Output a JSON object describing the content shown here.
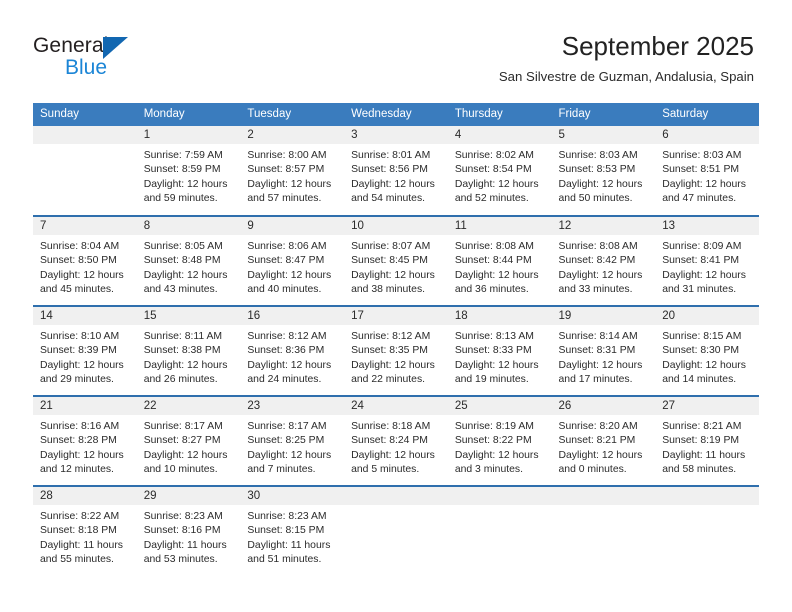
{
  "brand": {
    "name_top": "General",
    "name_bottom": "Blue",
    "triangle_color": "#1267b1",
    "blue_text_color": "#1b85d6"
  },
  "header": {
    "month_title": "September 2025",
    "location": "San Silvestre de Guzman, Andalusia, Spain",
    "header_bg": "#3a7cbe",
    "row_divider_color": "#2f6fad",
    "daynum_bg": "#f0f0f0"
  },
  "weekday_headers": [
    "Sunday",
    "Monday",
    "Tuesday",
    "Wednesday",
    "Thursday",
    "Friday",
    "Saturday"
  ],
  "weeks": [
    [
      {
        "day": "",
        "sunrise": "",
        "sunset": "",
        "daylight1": "",
        "daylight2": "",
        "empty": true
      },
      {
        "day": "1",
        "sunrise": "Sunrise: 7:59 AM",
        "sunset": "Sunset: 8:59 PM",
        "daylight1": "Daylight: 12 hours",
        "daylight2": "and 59 minutes."
      },
      {
        "day": "2",
        "sunrise": "Sunrise: 8:00 AM",
        "sunset": "Sunset: 8:57 PM",
        "daylight1": "Daylight: 12 hours",
        "daylight2": "and 57 minutes."
      },
      {
        "day": "3",
        "sunrise": "Sunrise: 8:01 AM",
        "sunset": "Sunset: 8:56 PM",
        "daylight1": "Daylight: 12 hours",
        "daylight2": "and 54 minutes."
      },
      {
        "day": "4",
        "sunrise": "Sunrise: 8:02 AM",
        "sunset": "Sunset: 8:54 PM",
        "daylight1": "Daylight: 12 hours",
        "daylight2": "and 52 minutes."
      },
      {
        "day": "5",
        "sunrise": "Sunrise: 8:03 AM",
        "sunset": "Sunset: 8:53 PM",
        "daylight1": "Daylight: 12 hours",
        "daylight2": "and 50 minutes."
      },
      {
        "day": "6",
        "sunrise": "Sunrise: 8:03 AM",
        "sunset": "Sunset: 8:51 PM",
        "daylight1": "Daylight: 12 hours",
        "daylight2": "and 47 minutes."
      }
    ],
    [
      {
        "day": "7",
        "sunrise": "Sunrise: 8:04 AM",
        "sunset": "Sunset: 8:50 PM",
        "daylight1": "Daylight: 12 hours",
        "daylight2": "and 45 minutes."
      },
      {
        "day": "8",
        "sunrise": "Sunrise: 8:05 AM",
        "sunset": "Sunset: 8:48 PM",
        "daylight1": "Daylight: 12 hours",
        "daylight2": "and 43 minutes."
      },
      {
        "day": "9",
        "sunrise": "Sunrise: 8:06 AM",
        "sunset": "Sunset: 8:47 PM",
        "daylight1": "Daylight: 12 hours",
        "daylight2": "and 40 minutes."
      },
      {
        "day": "10",
        "sunrise": "Sunrise: 8:07 AM",
        "sunset": "Sunset: 8:45 PM",
        "daylight1": "Daylight: 12 hours",
        "daylight2": "and 38 minutes."
      },
      {
        "day": "11",
        "sunrise": "Sunrise: 8:08 AM",
        "sunset": "Sunset: 8:44 PM",
        "daylight1": "Daylight: 12 hours",
        "daylight2": "and 36 minutes."
      },
      {
        "day": "12",
        "sunrise": "Sunrise: 8:08 AM",
        "sunset": "Sunset: 8:42 PM",
        "daylight1": "Daylight: 12 hours",
        "daylight2": "and 33 minutes."
      },
      {
        "day": "13",
        "sunrise": "Sunrise: 8:09 AM",
        "sunset": "Sunset: 8:41 PM",
        "daylight1": "Daylight: 12 hours",
        "daylight2": "and 31 minutes."
      }
    ],
    [
      {
        "day": "14",
        "sunrise": "Sunrise: 8:10 AM",
        "sunset": "Sunset: 8:39 PM",
        "daylight1": "Daylight: 12 hours",
        "daylight2": "and 29 minutes."
      },
      {
        "day": "15",
        "sunrise": "Sunrise: 8:11 AM",
        "sunset": "Sunset: 8:38 PM",
        "daylight1": "Daylight: 12 hours",
        "daylight2": "and 26 minutes."
      },
      {
        "day": "16",
        "sunrise": "Sunrise: 8:12 AM",
        "sunset": "Sunset: 8:36 PM",
        "daylight1": "Daylight: 12 hours",
        "daylight2": "and 24 minutes."
      },
      {
        "day": "17",
        "sunrise": "Sunrise: 8:12 AM",
        "sunset": "Sunset: 8:35 PM",
        "daylight1": "Daylight: 12 hours",
        "daylight2": "and 22 minutes."
      },
      {
        "day": "18",
        "sunrise": "Sunrise: 8:13 AM",
        "sunset": "Sunset: 8:33 PM",
        "daylight1": "Daylight: 12 hours",
        "daylight2": "and 19 minutes."
      },
      {
        "day": "19",
        "sunrise": "Sunrise: 8:14 AM",
        "sunset": "Sunset: 8:31 PM",
        "daylight1": "Daylight: 12 hours",
        "daylight2": "and 17 minutes."
      },
      {
        "day": "20",
        "sunrise": "Sunrise: 8:15 AM",
        "sunset": "Sunset: 8:30 PM",
        "daylight1": "Daylight: 12 hours",
        "daylight2": "and 14 minutes."
      }
    ],
    [
      {
        "day": "21",
        "sunrise": "Sunrise: 8:16 AM",
        "sunset": "Sunset: 8:28 PM",
        "daylight1": "Daylight: 12 hours",
        "daylight2": "and 12 minutes."
      },
      {
        "day": "22",
        "sunrise": "Sunrise: 8:17 AM",
        "sunset": "Sunset: 8:27 PM",
        "daylight1": "Daylight: 12 hours",
        "daylight2": "and 10 minutes."
      },
      {
        "day": "23",
        "sunrise": "Sunrise: 8:17 AM",
        "sunset": "Sunset: 8:25 PM",
        "daylight1": "Daylight: 12 hours",
        "daylight2": "and 7 minutes."
      },
      {
        "day": "24",
        "sunrise": "Sunrise: 8:18 AM",
        "sunset": "Sunset: 8:24 PM",
        "daylight1": "Daylight: 12 hours",
        "daylight2": "and 5 minutes."
      },
      {
        "day": "25",
        "sunrise": "Sunrise: 8:19 AM",
        "sunset": "Sunset: 8:22 PM",
        "daylight1": "Daylight: 12 hours",
        "daylight2": "and 3 minutes."
      },
      {
        "day": "26",
        "sunrise": "Sunrise: 8:20 AM",
        "sunset": "Sunset: 8:21 PM",
        "daylight1": "Daylight: 12 hours",
        "daylight2": "and 0 minutes."
      },
      {
        "day": "27",
        "sunrise": "Sunrise: 8:21 AM",
        "sunset": "Sunset: 8:19 PM",
        "daylight1": "Daylight: 11 hours",
        "daylight2": "and 58 minutes."
      }
    ],
    [
      {
        "day": "28",
        "sunrise": "Sunrise: 8:22 AM",
        "sunset": "Sunset: 8:18 PM",
        "daylight1": "Daylight: 11 hours",
        "daylight2": "and 55 minutes."
      },
      {
        "day": "29",
        "sunrise": "Sunrise: 8:23 AM",
        "sunset": "Sunset: 8:16 PM",
        "daylight1": "Daylight: 11 hours",
        "daylight2": "and 53 minutes."
      },
      {
        "day": "30",
        "sunrise": "Sunrise: 8:23 AM",
        "sunset": "Sunset: 8:15 PM",
        "daylight1": "Daylight: 11 hours",
        "daylight2": "and 51 minutes."
      },
      {
        "day": "",
        "sunrise": "",
        "sunset": "",
        "daylight1": "",
        "daylight2": "",
        "empty": true
      },
      {
        "day": "",
        "sunrise": "",
        "sunset": "",
        "daylight1": "",
        "daylight2": "",
        "empty": true
      },
      {
        "day": "",
        "sunrise": "",
        "sunset": "",
        "daylight1": "",
        "daylight2": "",
        "empty": true
      },
      {
        "day": "",
        "sunrise": "",
        "sunset": "",
        "daylight1": "",
        "daylight2": "",
        "empty": true
      }
    ]
  ]
}
